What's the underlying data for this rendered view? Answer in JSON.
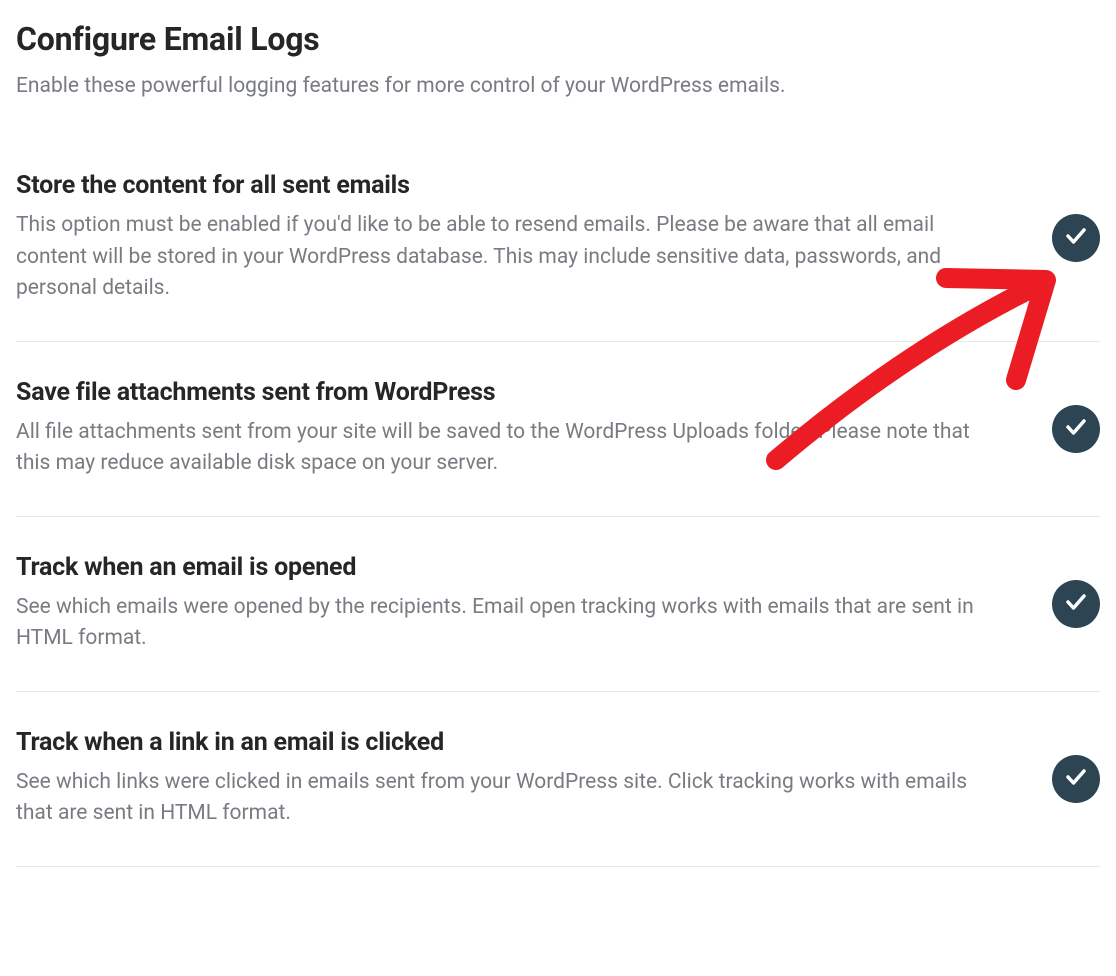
{
  "header": {
    "title": "Configure Email Logs",
    "subtitle": "Enable these powerful logging features for more control of your WordPress emails."
  },
  "options": [
    {
      "heading": "Store the content for all sent emails",
      "description": "This option must be enabled if you'd like to be able to resend emails. Please be aware that all email content will be stored in your WordPress database. This may include sensitive data, passwords, and personal details.",
      "enabled": true
    },
    {
      "heading": "Save file attachments sent from WordPress",
      "description": "All file attachments sent from your site will be saved to the WordPress Uploads folder. Please note that this may reduce available disk space on your server.",
      "enabled": true
    },
    {
      "heading": "Track when an email is opened",
      "description": "See which emails were opened by the recipients. Email open tracking works with emails that are sent in HTML format.",
      "enabled": true
    },
    {
      "heading": "Track when a link in an email is clicked",
      "description": "See which links were clicked in emails sent from your WordPress site. Click tracking works with emails that are sent in HTML format.",
      "enabled": true
    }
  ],
  "annotation": {
    "type": "hand-drawn-arrow",
    "color": "#ec1c24",
    "points_to": "options.0.toggle"
  }
}
